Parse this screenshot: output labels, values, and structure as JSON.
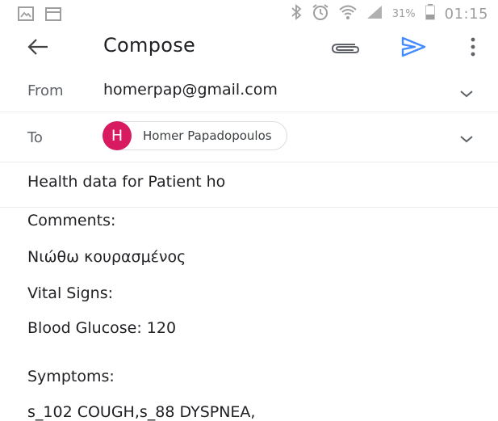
{
  "status_bar": {
    "icons": [
      "gallery-icon",
      "calendar-icon",
      "bluetooth-icon",
      "alarm-icon",
      "wifi-icon",
      "signal-icon",
      "battery-icon"
    ],
    "battery": "31%",
    "time": "01:15"
  },
  "app_bar": {
    "title": "Compose",
    "accent_color": "#448aff"
  },
  "from": {
    "label": "From",
    "value": "homerpap@gmail.com"
  },
  "to": {
    "label": "To",
    "recipient": {
      "initial": "H",
      "name": "Homer Papadopoulos",
      "avatar_color": "#d81b60"
    }
  },
  "subject": "Health data for Patient ho",
  "body": {
    "lines": [
      "Comments:",
      "Νιώθω κουρασμένος",
      "Vital Signs:",
      "Blood Glucose: 120",
      "Symptoms:",
      "s_102 COUGH,s_88 DYSPNEA,"
    ]
  }
}
